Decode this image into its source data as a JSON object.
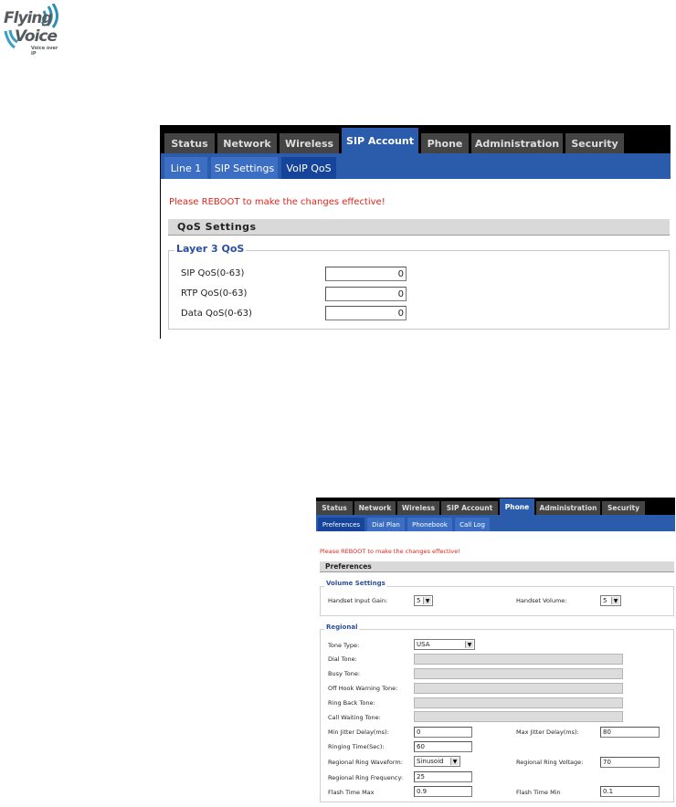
{
  "brand": {
    "line1": "Flying",
    "line2": "Voice",
    "tagline": "Voice over IP"
  },
  "colors": {
    "tab_active": "#2a5cab",
    "tab_inactive": "#444444",
    "notice": "#e0261c",
    "legend": "#2b4f9e"
  },
  "sip_panel": {
    "tabs": [
      "Status",
      "Network",
      "Wireless",
      "SIP Account",
      "Phone",
      "Administration",
      "Security"
    ],
    "active_tab": "SIP Account",
    "subtabs": [
      "Line 1",
      "SIP Settings",
      "VoIP QoS"
    ],
    "active_subtab": "VoIP QoS",
    "notice": "Please REBOOT to make the changes effective!",
    "section_title": "QoS Settings",
    "group_title": "Layer 3 QoS",
    "fields": [
      {
        "label": "SIP QoS(0-63)",
        "value": "0"
      },
      {
        "label": "RTP QoS(0-63)",
        "value": "0"
      },
      {
        "label": "Data QoS(0-63)",
        "value": "0"
      }
    ]
  },
  "phone_panel": {
    "tabs": [
      "Status",
      "Network",
      "Wireless",
      "SIP Account",
      "Phone",
      "Administration",
      "Security"
    ],
    "active_tab": "Phone",
    "subtabs": [
      "Preferences",
      "Dial Plan",
      "Phonebook",
      "Call Log"
    ],
    "active_subtab": "Preferences",
    "notice": "Please REBOOT to make the changes effective!",
    "section_title": "Preferences",
    "volume": {
      "title": "Volume Settings",
      "handset_input_gain_label": "Handset Input Gain:",
      "handset_input_gain_value": "5",
      "handset_volume_label": "Handset Volume:",
      "handset_volume_value": "5"
    },
    "regional": {
      "title": "Regional",
      "tone_type_label": "Tone Type:",
      "tone_type_value": "USA",
      "dial_tone_label": "Dial Tone:",
      "busy_tone_label": "Busy Tone:",
      "off_hook_label": "Off Hook Warning Tone:",
      "ring_back_label": "Ring Back Tone:",
      "call_waiting_label": "Call Waiting Tone:",
      "min_jitter_label": "Min Jitter Delay(ms):",
      "min_jitter_value": "0",
      "max_jitter_label": "Max Jitter Delay(ms):",
      "max_jitter_value": "80",
      "ringing_time_label": "Ringing Time(Sec):",
      "ringing_time_value": "60",
      "ring_waveform_label": "Regional Ring Waveform:",
      "ring_waveform_value": "Sinusoid",
      "ring_voltage_label": "Regional Ring Voltage:",
      "ring_voltage_value": "70",
      "ring_frequency_label": "Regional Ring Frequency:",
      "ring_frequency_value": "25",
      "flash_max_label": "Flash Time Max",
      "flash_max_value": "0.9",
      "flash_min_label": "Flash Time Min",
      "flash_min_value": "0.1"
    }
  }
}
